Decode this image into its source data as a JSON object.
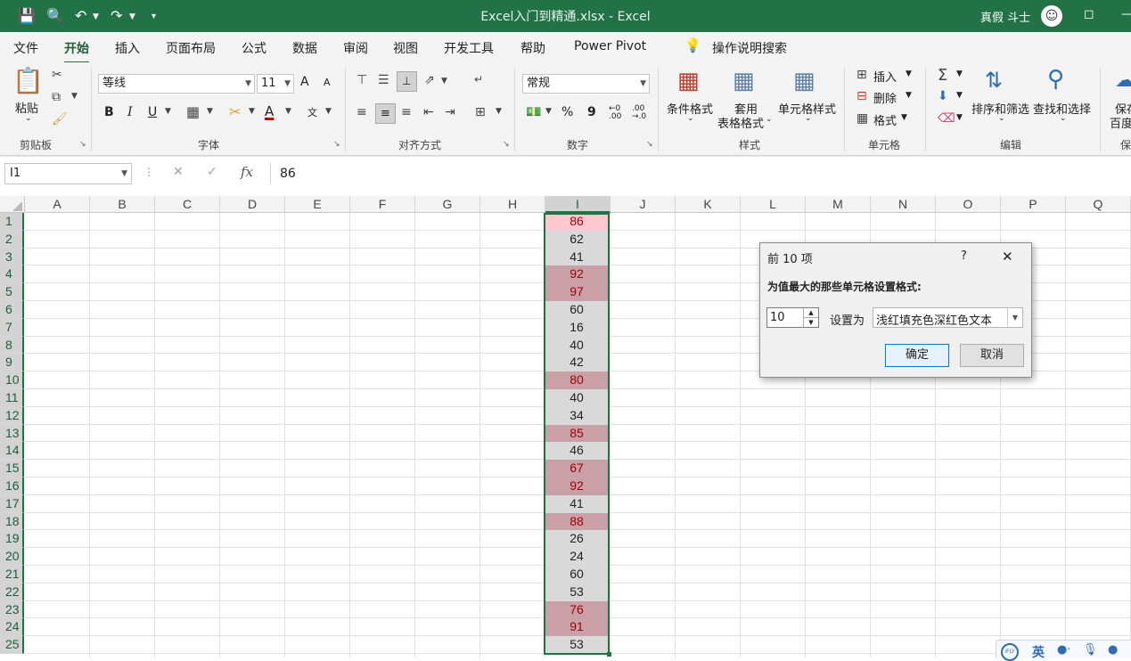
{
  "titlebar": {
    "title": "Excel入门到精通.xlsx  -  Excel",
    "user": "真假 斗士",
    "save_icon": "save-icon",
    "print_preview_icon": "print-preview-icon",
    "undo_icon": "undo-icon",
    "redo_icon": "redo-icon"
  },
  "tabs": [
    "文件",
    "开始",
    "插入",
    "页面布局",
    "公式",
    "数据",
    "审阅",
    "视图",
    "开发工具",
    "帮助",
    "Power Pivot"
  ],
  "tell_me": "操作说明搜索",
  "ribbon": {
    "clipboard": {
      "paste": "粘贴",
      "label": "剪贴板"
    },
    "font": {
      "name": "等线",
      "size": "11",
      "label": "字体",
      "bold": "B",
      "italic": "I",
      "underline": "U",
      "grow": "A",
      "shrink": "A",
      "font_color_letter": "A",
      "phonetic": "文"
    },
    "alignment": {
      "label": "对齐方式"
    },
    "number": {
      "format": "常规",
      "label": "数字",
      "percent": "%",
      "comma": "9"
    },
    "styles": {
      "conditional": "条件格式",
      "table_line1": "套用",
      "table_line2": "表格格式",
      "cell_styles": "单元格样式",
      "label": "样式"
    },
    "cells": {
      "insert": "插入",
      "delete": "删除",
      "format": "格式",
      "label": "单元格"
    },
    "editing": {
      "sort_filter": "排序和筛选",
      "find_select": "查找和选择",
      "label": "编辑"
    },
    "extra": {
      "line1": "保存",
      "line2": "百度",
      "label": "保"
    }
  },
  "formula_bar": {
    "name_box": "I1",
    "cancel": "✕",
    "enter": "✓",
    "fx": "fx",
    "value": "86"
  },
  "columns": [
    "A",
    "B",
    "C",
    "D",
    "E",
    "F",
    "G",
    "H",
    "I",
    "J",
    "K",
    "L",
    "M",
    "N",
    "O",
    "P",
    "Q"
  ],
  "rows": [
    "1",
    "2",
    "3",
    "4",
    "5",
    "6",
    "7",
    "8",
    "9",
    "10",
    "11",
    "12",
    "13",
    "14",
    "15",
    "16",
    "17",
    "18",
    "19",
    "20",
    "21",
    "22",
    "23",
    "24",
    "25"
  ],
  "column_i": {
    "values": [
      "86",
      "62",
      "41",
      "92",
      "97",
      "60",
      "16",
      "40",
      "42",
      "80",
      "40",
      "34",
      "85",
      "46",
      "67",
      "92",
      "41",
      "88",
      "26",
      "24",
      "60",
      "53",
      "76",
      "91",
      "53"
    ],
    "highlighted": [
      true,
      false,
      false,
      true,
      true,
      false,
      false,
      false,
      false,
      true,
      false,
      false,
      true,
      false,
      true,
      true,
      false,
      true,
      false,
      false,
      false,
      false,
      true,
      true,
      false
    ]
  },
  "colors": {
    "accent": "#217346",
    "highlight_fill": "#FFC7CE",
    "highlight_text": "#9C0006",
    "selection_fill": "#d9d9d9"
  },
  "dialog": {
    "title": "前 10 项",
    "help": "?",
    "close": "✕",
    "prompt": "为值最大的那些单元格设置格式:",
    "count": "10",
    "set_as": "设置为",
    "format_option": "浅红填充色深红色文本",
    "ok": "确定",
    "cancel": "取消"
  },
  "ime_toolbar": {
    "lang": "英"
  }
}
